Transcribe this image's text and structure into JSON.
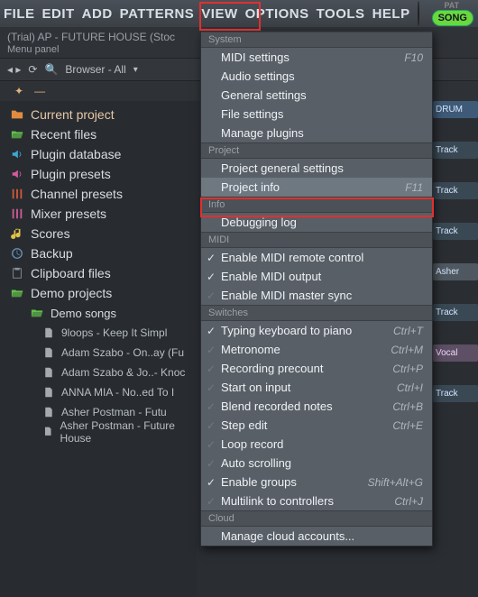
{
  "menubar": {
    "items": [
      "FILE",
      "EDIT",
      "ADD",
      "PATTERNS",
      "VIEW",
      "OPTIONS",
      "TOOLS",
      "HELP"
    ],
    "pat_label": "PAT",
    "song_label": "SONG"
  },
  "titlebar": {
    "line1": "(Trial) AP - FUTURE HOUSE (Stoc",
    "line2": "Menu panel"
  },
  "browser": {
    "arrows": "◂ ▸",
    "reload": "⟳",
    "search": "🔍",
    "label": "Browser - All",
    "expand": "▾",
    "sub_star": "✦",
    "sub_dash": "—"
  },
  "tree": [
    {
      "icon": "folder",
      "color": "#e28b3f",
      "label": "Current project",
      "interact": true
    },
    {
      "icon": "folder-open",
      "color": "#62c04b",
      "label": "Recent files",
      "interact": true
    },
    {
      "icon": "speaker",
      "color": "#3aa7d6",
      "label": "Plugin database",
      "interact": true
    },
    {
      "icon": "speaker",
      "color": "#d65a9e",
      "label": "Plugin presets",
      "interact": true
    },
    {
      "icon": "sliders",
      "color": "#d65a3a",
      "label": "Channel presets",
      "interact": true
    },
    {
      "icon": "sliders",
      "color": "#d65a9e",
      "label": "Mixer presets",
      "interact": true
    },
    {
      "icon": "note",
      "color": "#e0c24a",
      "label": "Scores",
      "interact": true
    },
    {
      "icon": "clock",
      "color": "#6a93b8",
      "label": "Backup",
      "interact": true
    },
    {
      "icon": "clipboard",
      "color": "#8a919a",
      "label": "Clipboard files",
      "interact": true
    },
    {
      "icon": "folder-open",
      "color": "#62c04b",
      "label": "Demo projects",
      "interact": true
    },
    {
      "icon": "folder-open",
      "color": "#62c04b",
      "label": "Demo songs",
      "depth": 1,
      "interact": true
    },
    {
      "icon": "file",
      "color": "#a5aab0",
      "label": "9loops - Keep It Simpl",
      "depth": 2,
      "interact": true
    },
    {
      "icon": "file",
      "color": "#a5aab0",
      "label": "Adam Szabo - On..ay (Fu",
      "depth": 2,
      "interact": true
    },
    {
      "icon": "file",
      "color": "#a5aab0",
      "label": "Adam Szabo & Jo..- Knoc",
      "depth": 2,
      "interact": true
    },
    {
      "icon": "file",
      "color": "#a5aab0",
      "label": "ANNA MIA - No..ed To I",
      "depth": 2,
      "interact": true
    },
    {
      "icon": "file",
      "color": "#a5aab0",
      "label": "Asher Postman - Futu",
      "depth": 2,
      "interact": true
    },
    {
      "icon": "file",
      "color": "#a5aab0",
      "label": "Asher Postman - Future House",
      "depth": 2,
      "interact": true
    }
  ],
  "dropdown": {
    "sections": [
      {
        "title": "System",
        "items": [
          {
            "label": "MIDI settings",
            "shortcut": "F10"
          },
          {
            "label": "Audio settings"
          },
          {
            "label": "General settings"
          },
          {
            "label": "File settings"
          },
          {
            "label": "Manage plugins"
          }
        ]
      },
      {
        "title": "Project",
        "items": [
          {
            "label": "Project general settings"
          },
          {
            "label": "Project info",
            "shortcut": "F11",
            "highlight": true
          }
        ]
      },
      {
        "title": "Info",
        "items": [
          {
            "label": "Debugging log"
          }
        ]
      },
      {
        "title": "MIDI",
        "items": [
          {
            "label": "Enable MIDI remote control",
            "checked": true
          },
          {
            "label": "Enable MIDI output",
            "checked": true
          },
          {
            "label": "Enable MIDI master sync",
            "checked": false
          }
        ]
      },
      {
        "title": "Switches",
        "items": [
          {
            "label": "Typing keyboard to piano",
            "shortcut": "Ctrl+T",
            "checked": true
          },
          {
            "label": "Metronome",
            "shortcut": "Ctrl+M",
            "checked": false
          },
          {
            "label": "Recording precount",
            "shortcut": "Ctrl+P",
            "checked": false
          },
          {
            "label": "Start on input",
            "shortcut": "Ctrl+I",
            "checked": false
          },
          {
            "label": "Blend recorded notes",
            "shortcut": "Ctrl+B",
            "checked": false
          },
          {
            "label": "Step edit",
            "shortcut": "Ctrl+E",
            "checked": false
          },
          {
            "label": "Loop record",
            "checked": false
          },
          {
            "label": "Auto scrolling",
            "checked": false
          },
          {
            "label": "Enable groups",
            "shortcut": "Shift+Alt+G",
            "checked": true
          },
          {
            "label": "Multilink to controllers",
            "shortcut": "Ctrl+J",
            "checked": false
          }
        ]
      },
      {
        "title": "Cloud",
        "items": [
          {
            "label": "Manage cloud accounts..."
          }
        ]
      }
    ]
  },
  "tracks": [
    {
      "label": "DRUM",
      "cls": "dr"
    },
    {
      "label": "Track",
      "cls": "tk"
    },
    {
      "label": "Track",
      "cls": "tk"
    },
    {
      "label": "Track",
      "cls": "tk"
    },
    {
      "label": "Asher",
      "cls": "ash"
    },
    {
      "label": "Track",
      "cls": "tk"
    },
    {
      "label": "Vocal",
      "cls": "vo"
    },
    {
      "label": "Track",
      "cls": "tk"
    }
  ]
}
